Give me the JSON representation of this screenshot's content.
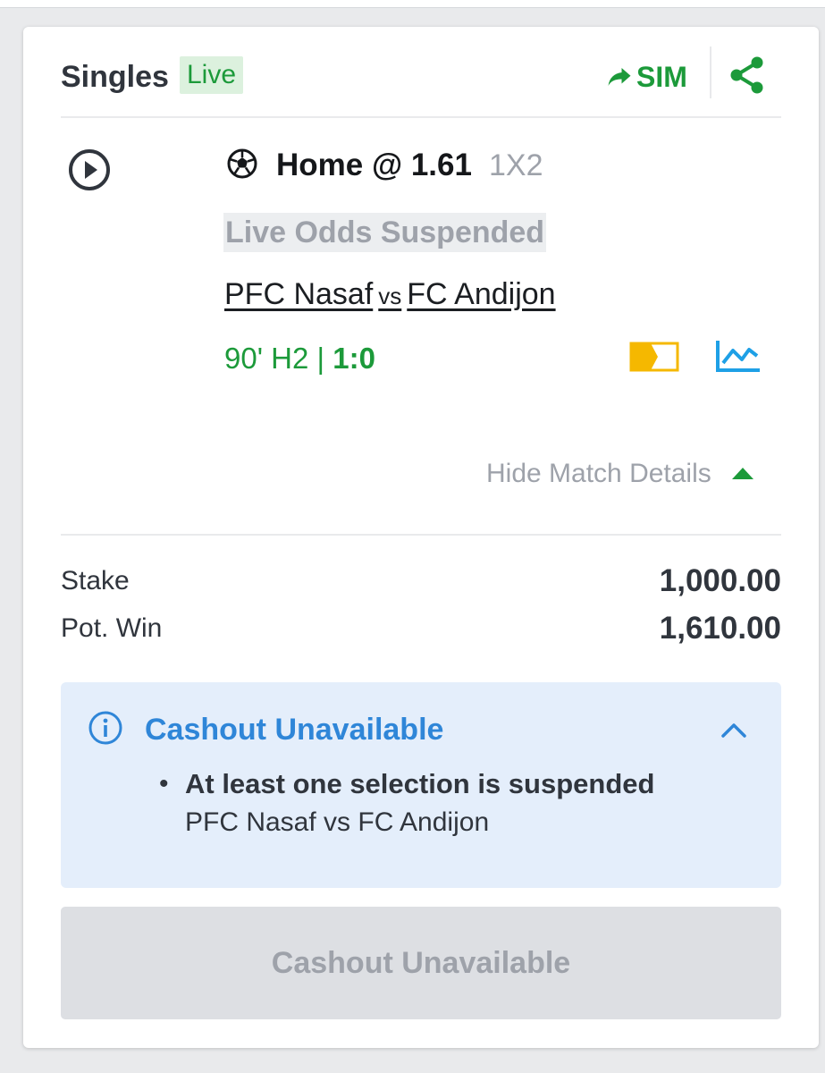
{
  "header": {
    "title": "Singles",
    "live_badge": "Live",
    "sim_label": "SIM",
    "share_icon": "share-icon"
  },
  "selection": {
    "pick": "Home @ 1.61",
    "market": "1X2",
    "odds_status": "Live Odds Suspended",
    "home_team": "PFC Nasaf",
    "vs": "vs",
    "away_team": "FC Andijon",
    "match_time": "90' H2 |",
    "score": "1:0",
    "hide_details_label": "Hide Match Details"
  },
  "bet": {
    "stake_label": "Stake",
    "stake_value": "1,000.00",
    "potwin_label": "Pot. Win",
    "potwin_value": "1,610.00"
  },
  "cashout_info": {
    "title": "Cashout Unavailable",
    "reason": "At least one selection is suspended",
    "match": "PFC Nasaf vs FC Andijon"
  },
  "cashout_button": {
    "label": "Cashout Unavailable"
  },
  "colors": {
    "green": "#1c9a3a",
    "blue": "#2f86d8",
    "orange": "#f5b800",
    "stats_blue": "#1ea0e6"
  }
}
